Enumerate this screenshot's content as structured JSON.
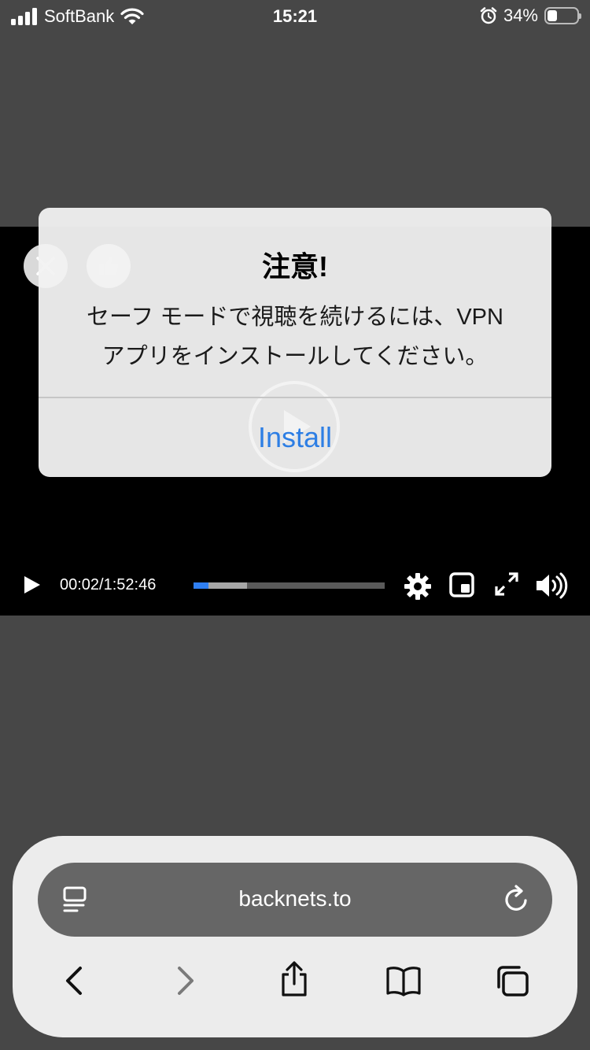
{
  "status_bar": {
    "carrier": "SoftBank",
    "time": "15:21",
    "battery_text": "34%",
    "battery_level": 0.34
  },
  "alert": {
    "title": "注意!",
    "message_line1": "セーフ モードで視聴を続けるには、VPN",
    "message_line2": "アプリをインストールしてください。",
    "button_label": "Install",
    "button_color": "#2d7ee4"
  },
  "player": {
    "time_display": "00:02/1:52:46",
    "played_fraction": 0.08,
    "buffered_fraction": 0.28,
    "progress_color": "#2f7ff2"
  },
  "browser": {
    "url": "backnets.to"
  }
}
